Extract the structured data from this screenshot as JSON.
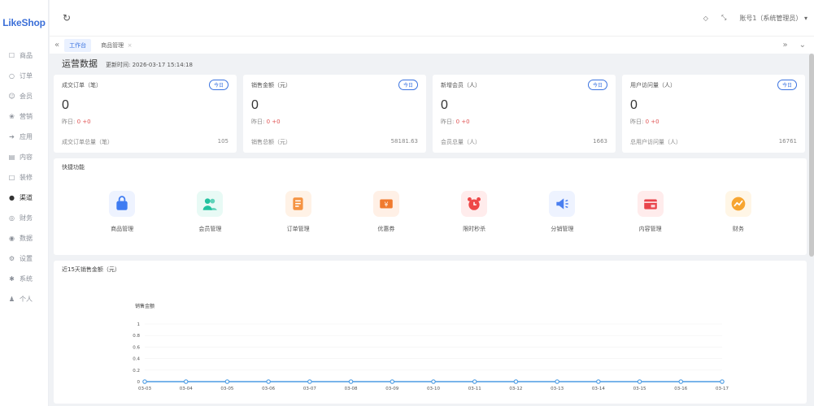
{
  "brand": {
    "logo": "LikeShop"
  },
  "sidebar": {
    "items": [
      {
        "label": "商品",
        "icon": "cart-icon"
      },
      {
        "label": "订单",
        "icon": "order-icon"
      },
      {
        "label": "会员",
        "icon": "user-icon"
      },
      {
        "label": "营销",
        "icon": "gift-icon"
      },
      {
        "label": "应用",
        "icon": "send-icon"
      },
      {
        "label": "内容",
        "icon": "content-icon"
      },
      {
        "label": "装修",
        "icon": "decor-icon"
      },
      {
        "label": "渠道",
        "icon": "channel-icon"
      },
      {
        "label": "财务",
        "icon": "finance-icon"
      },
      {
        "label": "数据",
        "icon": "data-icon"
      },
      {
        "label": "设置",
        "icon": "settings-icon"
      },
      {
        "label": "系统",
        "icon": "system-icon"
      },
      {
        "label": "个人",
        "icon": "person-icon"
      }
    ]
  },
  "topbar": {
    "refresh_icon": "refresh-icon",
    "account": "账号1（系统管理员）"
  },
  "tabs": {
    "items": [
      {
        "label": "工作台",
        "active": true
      },
      {
        "label": "商品管理",
        "active": false
      }
    ],
    "close_mark": "×"
  },
  "ops": {
    "title": "运营数据",
    "updated_label": "更新时间:",
    "updated_time": "2026-03-17 15:14:18"
  },
  "stats": [
    {
      "title": "成交订单（笔）",
      "badge": "今日",
      "value": "0",
      "yest_label": "昨日: ",
      "yest_value": "0 +0",
      "total_label": "成交订单总量（笔）",
      "total_value": "105"
    },
    {
      "title": "销售金额（元）",
      "badge": "今日",
      "value": "0",
      "yest_label": "昨日: ",
      "yest_value": "0 +0",
      "total_label": "销售总额（元）",
      "total_value": "58181.63"
    },
    {
      "title": "新增会员（人）",
      "badge": "今日",
      "value": "0",
      "yest_label": "昨日: ",
      "yest_value": "0 +0",
      "total_label": "会员总量（人）",
      "total_value": "1663"
    },
    {
      "title": "用户访问量（人）",
      "badge": "今日",
      "value": "0",
      "yest_label": "昨日: ",
      "yest_value": "0 +0",
      "total_label": "总用户访问量（人）",
      "total_value": "16761"
    }
  ],
  "quick": {
    "title": "快捷功能",
    "items": [
      {
        "label": "商品管理",
        "icon": "bag-icon",
        "color": "#3f7cf2",
        "bg": "#eef3ff"
      },
      {
        "label": "会员管理",
        "icon": "members-icon",
        "color": "#23c2a0",
        "bg": "#e8faf5"
      },
      {
        "label": "订单管理",
        "icon": "order-doc-icon",
        "color": "#f59342",
        "bg": "#fff2e6"
      },
      {
        "label": "优惠券",
        "icon": "coupon-icon",
        "color": "#f07a2e",
        "bg": "#fff0e6"
      },
      {
        "label": "限时秒杀",
        "icon": "alarm-icon",
        "color": "#ee4848",
        "bg": "#ffecec"
      },
      {
        "label": "分销管理",
        "icon": "speaker-icon",
        "color": "#4a7ff0",
        "bg": "#eef3ff"
      },
      {
        "label": "内容管理",
        "icon": "content-card-icon",
        "color": "#e9434a",
        "bg": "#ffecec"
      },
      {
        "label": "财务",
        "icon": "finance-circle-icon",
        "color": "#f7a530",
        "bg": "#fff6e6"
      }
    ]
  },
  "chart_data": {
    "type": "line",
    "title": "近15天销售金额（元）",
    "legend_label": "销售金额",
    "categories": [
      "03-03",
      "03-04",
      "03-05",
      "03-06",
      "03-07",
      "03-08",
      "03-09",
      "03-10",
      "03-11",
      "03-12",
      "03-13",
      "03-14",
      "03-15",
      "03-16",
      "03-17"
    ],
    "series": [
      {
        "name": "销售金额",
        "values": [
          0,
          0,
          0,
          0,
          0,
          0,
          0,
          0,
          0,
          0,
          0,
          0,
          0,
          0,
          0
        ]
      }
    ],
    "y_ticks": [
      "0",
      "0.2",
      "0.4",
      "0.6",
      "0.8",
      "1"
    ],
    "ylim": [
      0,
      1
    ],
    "color": "#4b9be3",
    "grid": true
  }
}
